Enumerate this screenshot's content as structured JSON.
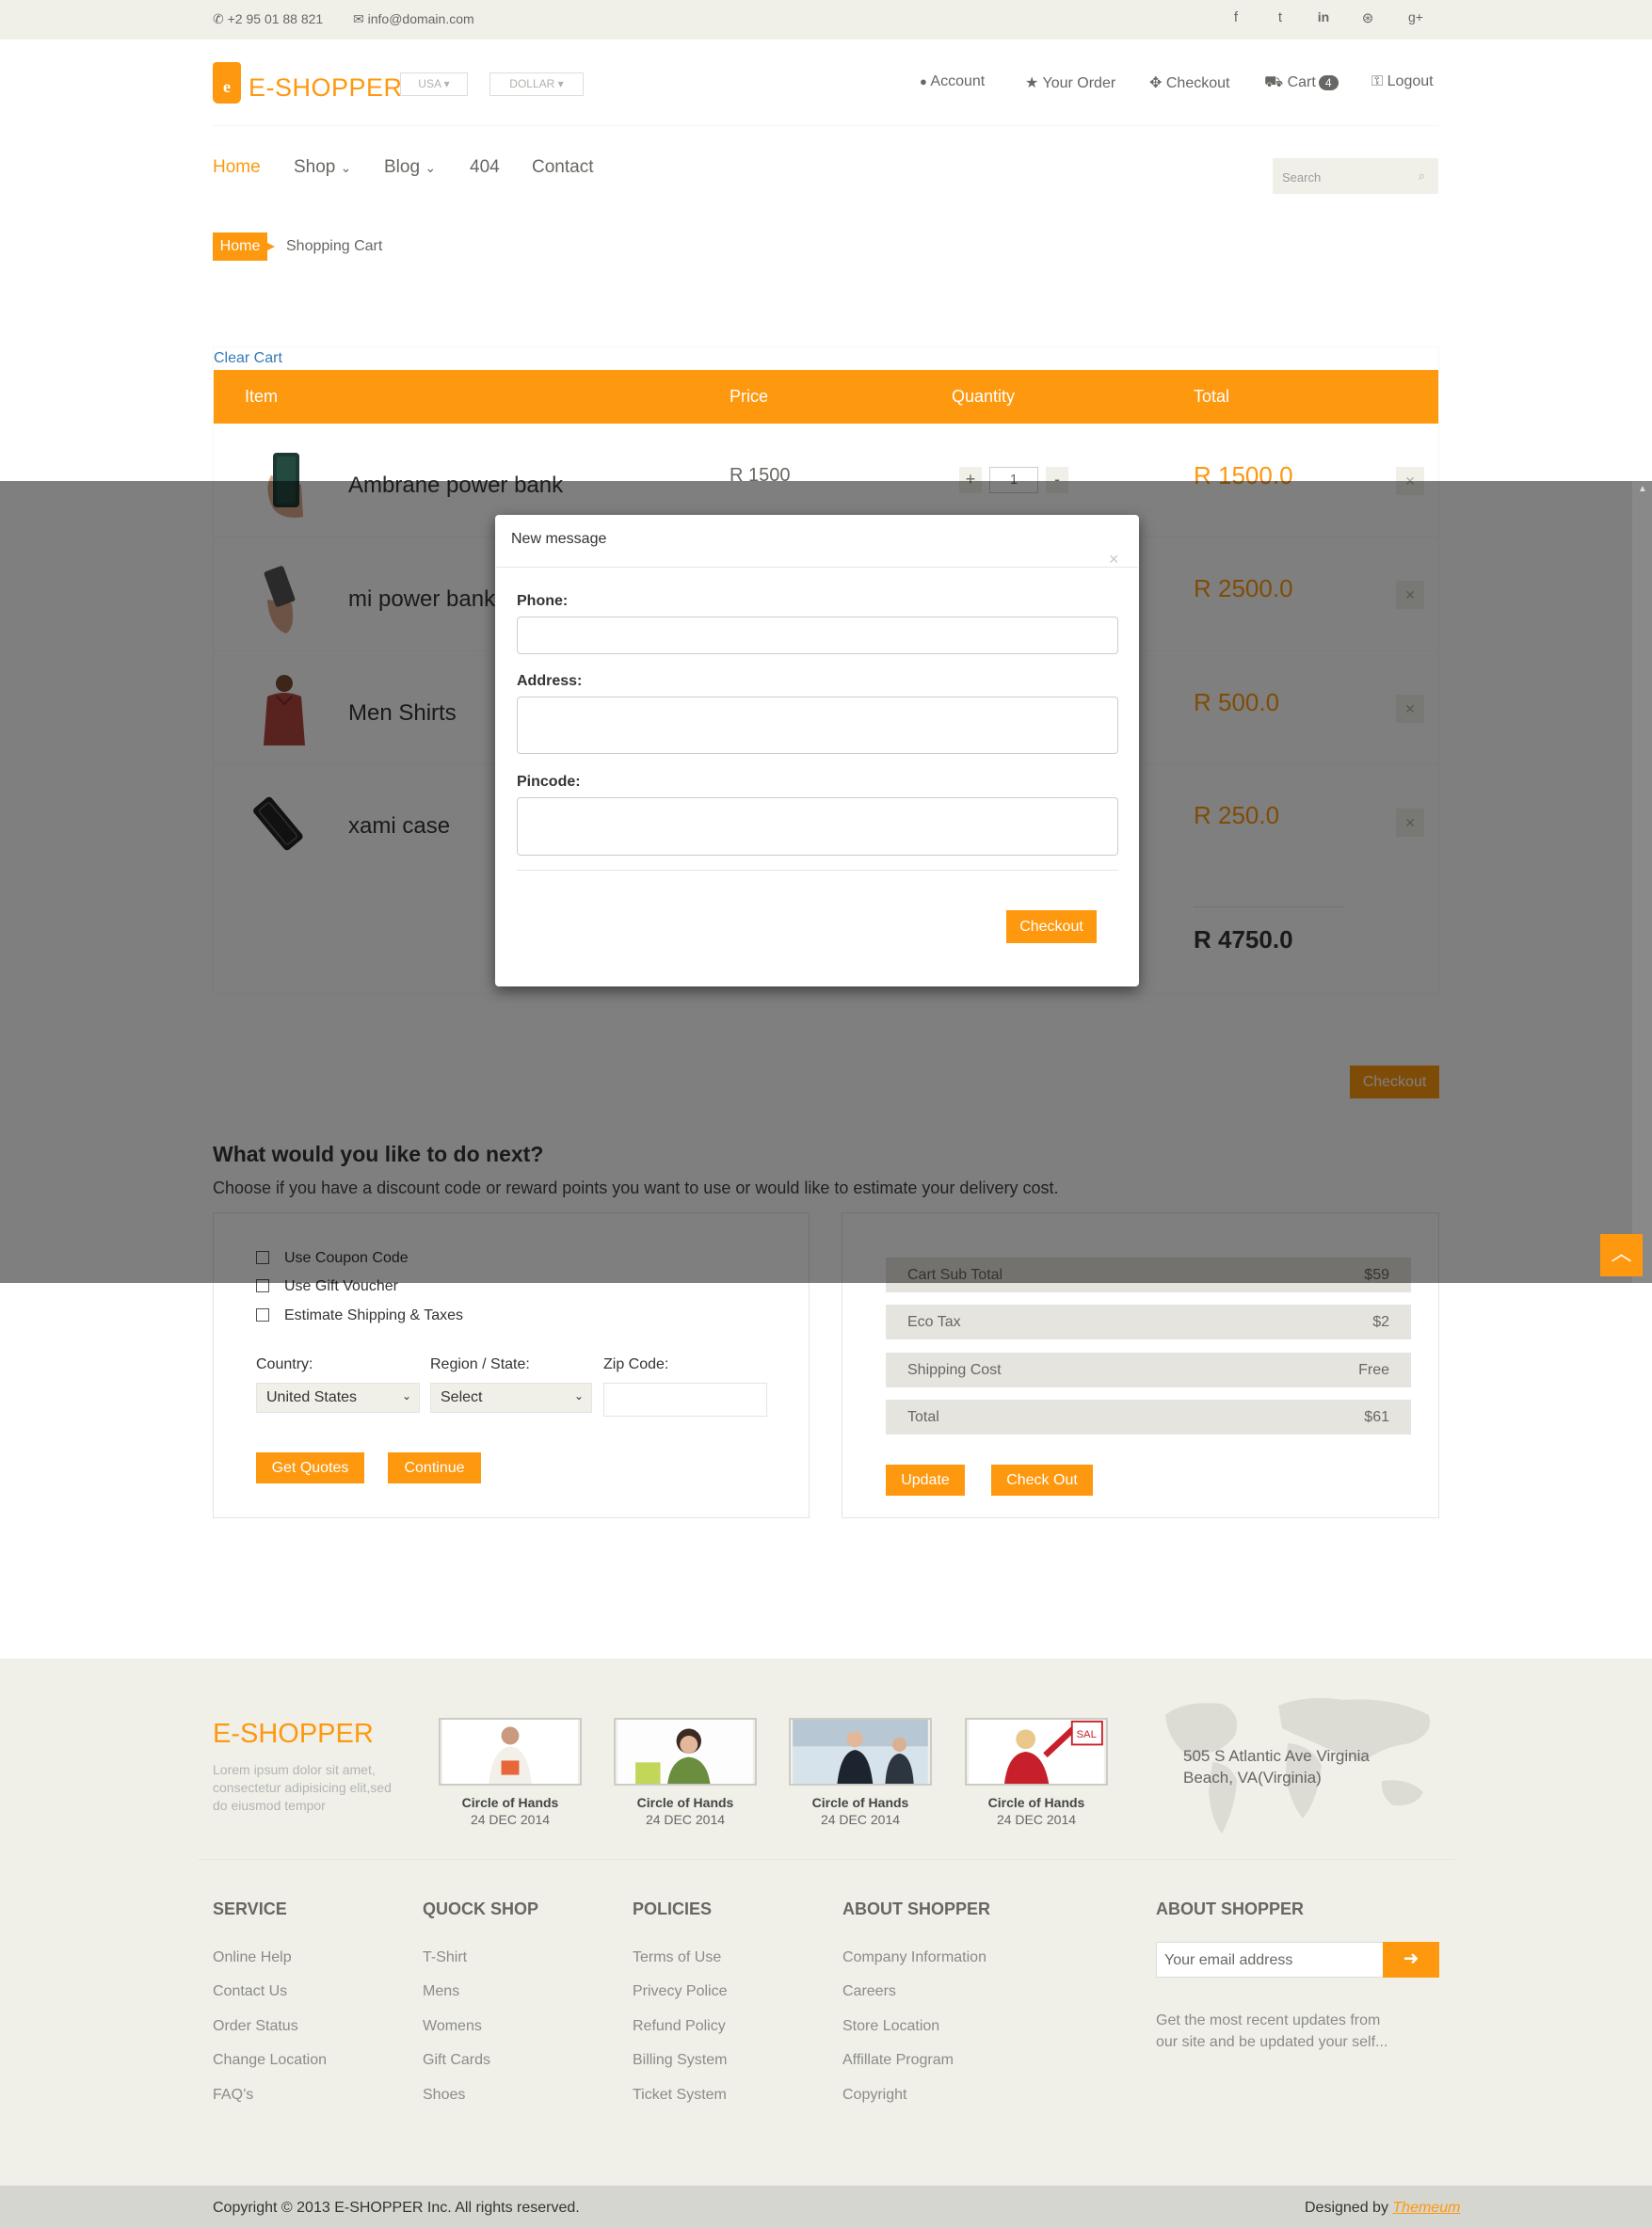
{
  "topbar": {
    "phone": "+2 95 01 88 821",
    "email": "info@domain.com",
    "social_icons": [
      "facebook-icon",
      "twitter-icon",
      "linkedin-icon",
      "dribbble-icon",
      "google-plus-icon"
    ],
    "social_glyphs": [
      "f",
      "t",
      "in",
      "⊛",
      "g+"
    ]
  },
  "header": {
    "logo_letter": "e",
    "logo_text": "E-SHOPPER",
    "country": "USA",
    "currency": "DOLLAR",
    "nav": [
      {
        "label": "Account",
        "icon": "👤"
      },
      {
        "label": "Your Order",
        "icon": "★"
      },
      {
        "label": "Checkout",
        "icon": "✥"
      },
      {
        "label": "Cart",
        "icon": "🛒",
        "badge": "4"
      },
      {
        "label": "Logout",
        "icon": "🔓"
      }
    ]
  },
  "mainnav": {
    "items": [
      "Home",
      "Shop",
      "Blog",
      "404",
      "Contact"
    ],
    "search_placeholder": "Search"
  },
  "breadcrumb": {
    "home": "Home",
    "current": "Shopping Cart"
  },
  "cart": {
    "clear_label": "Clear Cart",
    "headers": {
      "item": "Item",
      "price": "Price",
      "quantity": "Quantity",
      "total": "Total"
    },
    "rows": [
      {
        "name": "Ambrane power bank",
        "price": "R 1500",
        "qty": "1",
        "total": "R 1500.0"
      },
      {
        "name": "mi power bank",
        "price": "",
        "qty": "",
        "total": "R 2500.0"
      },
      {
        "name": "Men Shirts",
        "price": "",
        "qty": "",
        "total": "R 500.0"
      },
      {
        "name": "xami case",
        "price": "",
        "qty": "",
        "total": "R 250.0"
      }
    ],
    "plus": "+",
    "minus": "-",
    "grand_total": "R 4750.0",
    "checkout_label": "Checkout"
  },
  "modal": {
    "title": "New message",
    "close": "×",
    "phone_label": "Phone:",
    "address_label": "Address:",
    "pincode_label": "Pincode:",
    "checkout_label": "Checkout"
  },
  "next": {
    "heading": "What would you like to do next?",
    "text": "Choose if you have a discount code or reward points you want to use or would like to estimate your delivery cost.",
    "options": [
      "Use Coupon Code",
      "Use Gift Voucher",
      "Estimate Shipping & Taxes"
    ],
    "country_label": "Country:",
    "country_value": "United States",
    "region_label": "Region / State:",
    "region_value": "Select",
    "zip_label": "Zip Code:",
    "get_quotes": "Get Quotes",
    "continue": "Continue"
  },
  "summary": {
    "rows": [
      {
        "label": "Cart Sub Total",
        "value": "$59"
      },
      {
        "label": "Eco Tax",
        "value": "$2"
      },
      {
        "label": "Shipping Cost",
        "value": "Free"
      },
      {
        "label": "Total",
        "value": "$61"
      }
    ],
    "update": "Update",
    "checkout": "Check Out"
  },
  "footer": {
    "logo": "E-SHOPPER",
    "lorem": "Lorem ipsum dolor sit amet, consectetur adipisicing elit,sed do eiusmod tempor",
    "videos": [
      {
        "title": "Circle of Hands",
        "date": "24 DEC 2014"
      },
      {
        "title": "Circle of Hands",
        "date": "24 DEC 2014"
      },
      {
        "title": "Circle of Hands",
        "date": "24 DEC 2014"
      },
      {
        "title": "Circle of Hands",
        "date": "24 DEC 2014"
      }
    ],
    "address": "505 S Atlantic Ave Virginia Beach, VA(Virginia)",
    "columns": [
      {
        "heading": "SERVICE",
        "links": [
          "Online Help",
          "Contact Us",
          "Order Status",
          "Change Location",
          "FAQ’s"
        ]
      },
      {
        "heading": "QUOCK SHOP",
        "links": [
          "T-Shirt",
          "Mens",
          "Womens",
          "Gift Cards",
          "Shoes"
        ]
      },
      {
        "heading": "POLICIES",
        "links": [
          "Terms of Use",
          "Privecy Police",
          "Refund Policy",
          "Billing System",
          "Ticket System"
        ]
      },
      {
        "heading": "ABOUT SHOPPER",
        "links": [
          "Company Information",
          "Careers",
          "Store Location",
          "Affillate Program",
          "Copyright"
        ]
      }
    ],
    "subscribe_heading": "ABOUT SHOPPER",
    "email_placeholder": "Your email address",
    "subscribe_text": "Get the most recent updates from our site and be updated your self...",
    "copyright": "Copyright © 2013 E-SHOPPER Inc. All rights reserved.",
    "designed_prefix": "Designed by ",
    "designer": "Themeum"
  },
  "colors": {
    "accent": "#FE980F",
    "topbar": "#F0F0E9",
    "text": "#696763"
  }
}
